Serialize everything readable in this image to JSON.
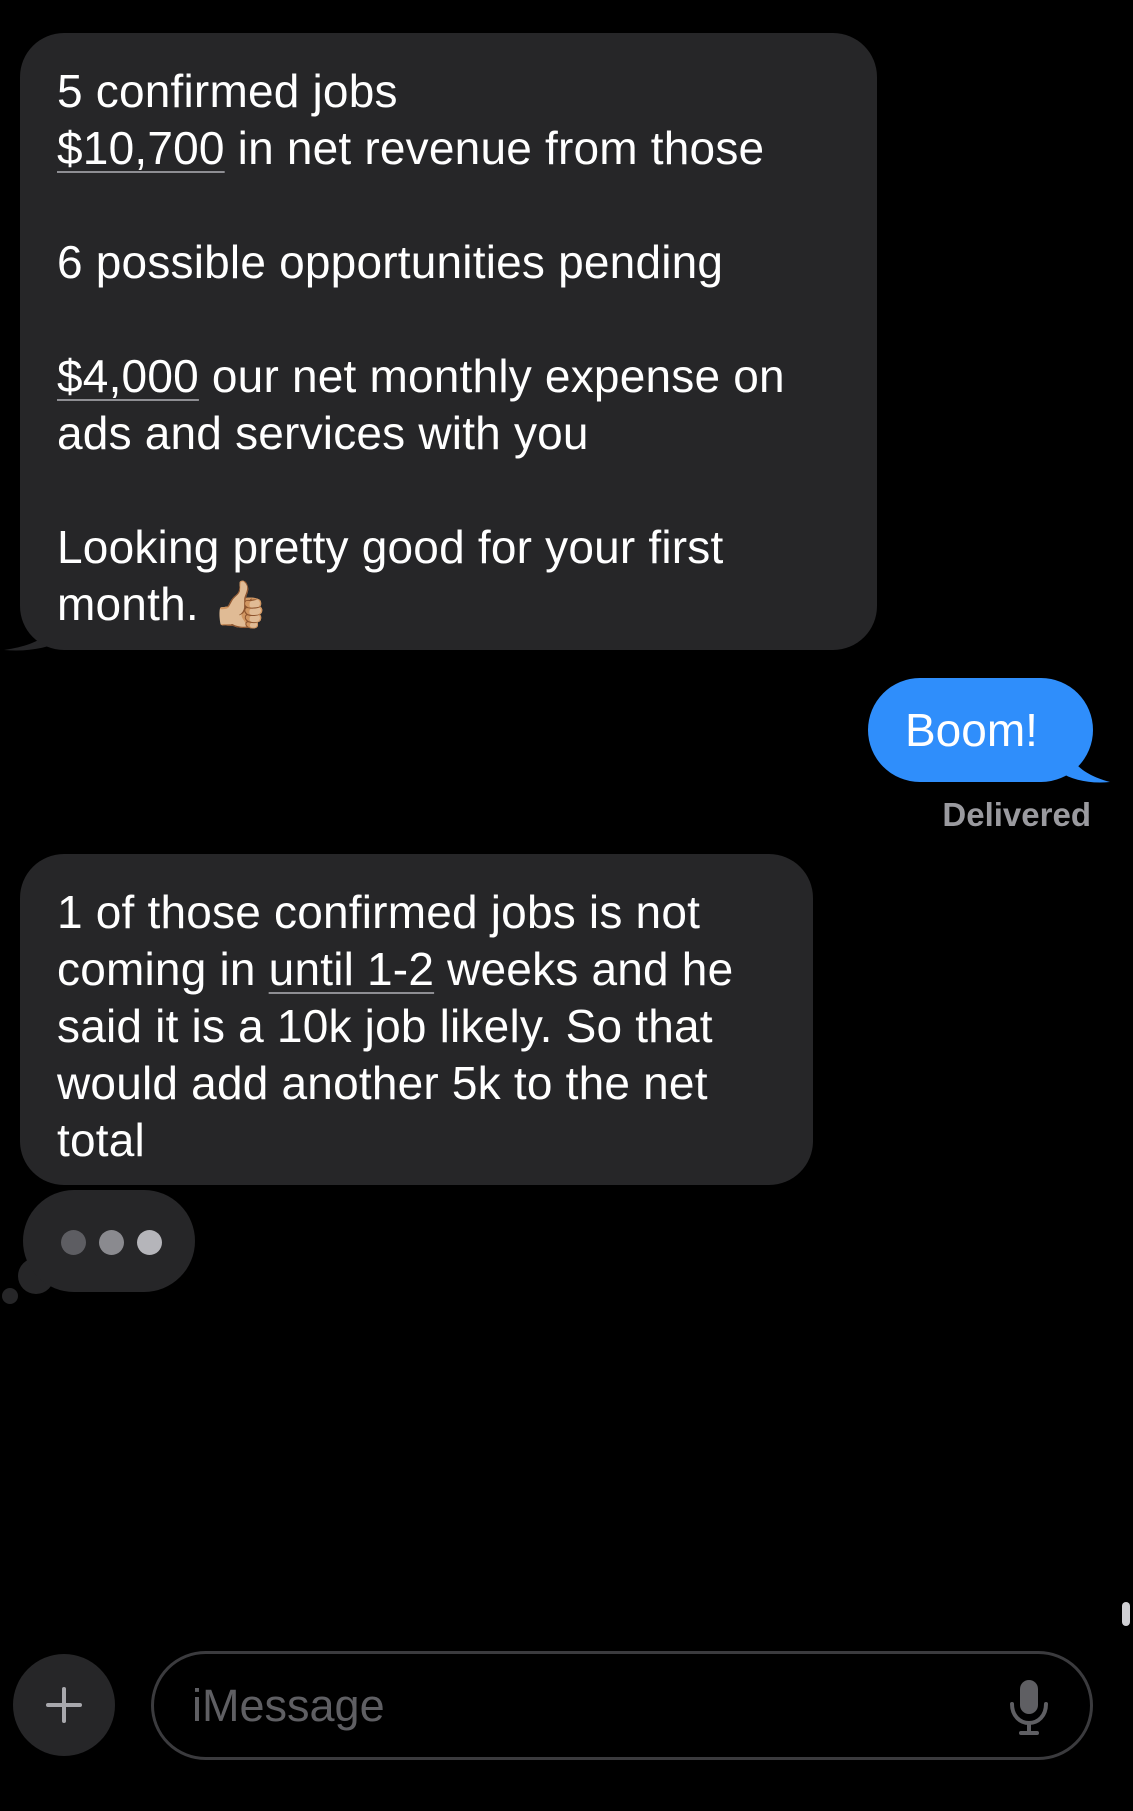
{
  "messages": {
    "incoming1": {
      "line1": "5 confirmed jobs",
      "line2_link": "$10,700",
      "line2_rest": " in net revenue from those",
      "line3": "6 possible opportunities pending",
      "line4_link": "$4,000",
      "line4_rest": " our net monthly expense on",
      "line5": "ads and services with you",
      "line6": "Looking pretty good for your first",
      "line7": "month. ",
      "emoji": "👍🏼"
    },
    "outgoing1": {
      "text": "Boom!",
      "status": "Delivered"
    },
    "incoming2": {
      "line1": "1 of those confirmed jobs is not",
      "line2_pre": "coming in ",
      "line2_link": "until 1-2",
      "line2_post": " weeks and he",
      "line3": "said it is a 10k job likely.  So that",
      "line4": "would add another 5k to the net",
      "line5": "total"
    }
  },
  "composer": {
    "placeholder": "iMessage",
    "plus_icon": "plus-icon",
    "mic_icon": "microphone-icon"
  },
  "colors": {
    "incoming_bubble": "#262628",
    "outgoing_bubble": "#2f8efb",
    "background": "#000000"
  }
}
